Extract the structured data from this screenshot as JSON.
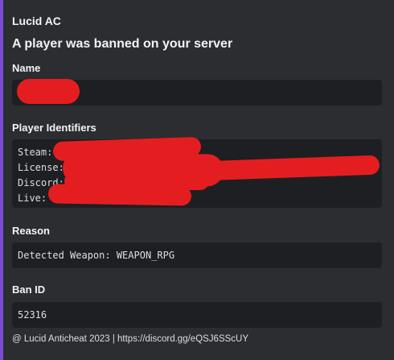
{
  "embed": {
    "accent_color": "#7b4bd6",
    "author": "Lucid AC",
    "title": "A player was banned on your server",
    "fields": [
      {
        "name": "Name",
        "value": ""
      },
      {
        "name": "Player Identifiers",
        "lines": [
          "Steam:",
          "License:",
          "Discord:",
          "Live:"
        ]
      },
      {
        "name": "Reason",
        "value": "Detected Weapon: WEAPON_RPG"
      },
      {
        "name": "Ban ID",
        "value": "52316"
      }
    ],
    "footer": "@ Lucid Anticheat 2023 | https://discord.gg/eQSJ6SScUY",
    "redaction_color": "#e41e20"
  }
}
